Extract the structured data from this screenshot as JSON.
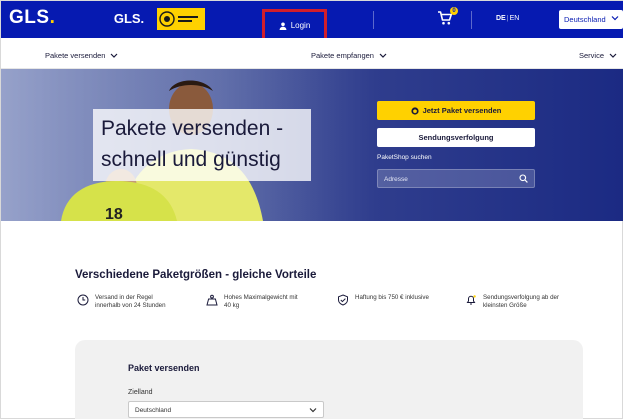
{
  "header": {
    "logo_text": "GLS",
    "logo_dot": ".",
    "login_label": "Login",
    "cart_count": "0",
    "lang_active": "DE",
    "lang_separator": "|",
    "lang_other": "EN",
    "country_value": "Deutschland"
  },
  "nav": {
    "items": [
      {
        "label": "Pakete versenden"
      },
      {
        "label": "Pakete empfangen"
      },
      {
        "label": "Service"
      }
    ]
  },
  "hero": {
    "badge_text": "GLS.",
    "headline_line1": "Pakete versenden -",
    "headline_line2": "schnell und günstig",
    "cta_primary": "Jetzt Paket versenden",
    "cta_secondary": "Sendungsverfolgung",
    "paketshop_label": "PaketShop suchen",
    "paketshop_placeholder": "Adresse"
  },
  "features": {
    "title": "Verschiedene Paketgrößen - gleiche Vorteile",
    "items": [
      {
        "icon": "clock-icon",
        "line1": "Versand in der Regel",
        "line2": "innerhalb von 24 Stunden"
      },
      {
        "icon": "weight-icon",
        "line1": "Hohes Maximalgewicht mit",
        "line2": "40 kg"
      },
      {
        "icon": "shield-icon",
        "line1": "Haftung bis 750 € inklusive",
        "line2": ""
      },
      {
        "icon": "bell-icon",
        "line1": "Sendungsverfolgung ab der",
        "line2": "kleinsten Größe"
      }
    ]
  },
  "form": {
    "title": "Paket versenden",
    "destination_label": "Zielland",
    "destination_value": "Deutschland"
  },
  "colors": {
    "brand_blue": "#061ab1",
    "brand_yellow": "#ffd100",
    "highlight_red": "#d21e2b"
  }
}
